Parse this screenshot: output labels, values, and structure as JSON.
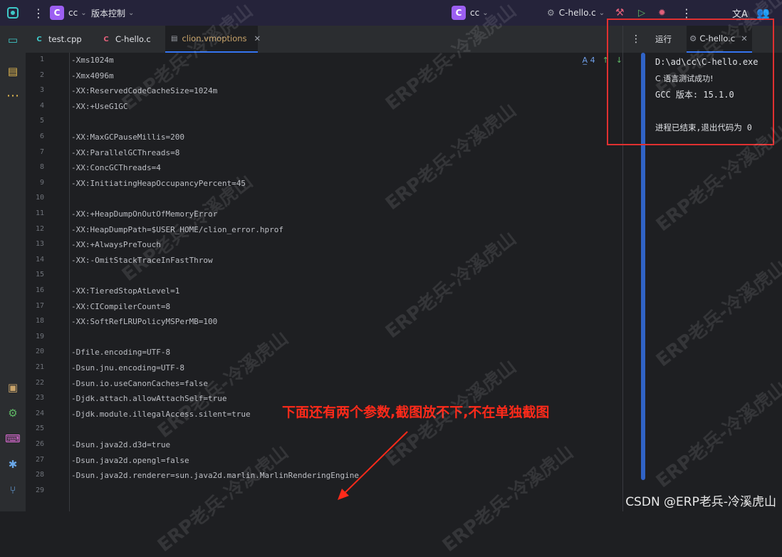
{
  "titlebar": {
    "project_badge": "C",
    "project_name": "cc",
    "vcs_label": "版本控制",
    "center_badge": "C",
    "center_name": "cc",
    "run_config": "C-hello.c"
  },
  "tabs": [
    {
      "label": "test.cpp",
      "icon": "C"
    },
    {
      "label": "C-hello.c",
      "icon": "C"
    },
    {
      "label": "clion.vmoptions",
      "icon": "file"
    }
  ],
  "editor": {
    "inspection_count": "4",
    "lines": [
      {
        "num": "1",
        "text": "-Xms1024m"
      },
      {
        "num": "2",
        "text": "-Xmx4096m"
      },
      {
        "num": "3",
        "text": "-XX:ReservedCodeCacheSize=1024m"
      },
      {
        "num": "4",
        "text": "-XX:+UseG1GC"
      },
      {
        "num": "5",
        "text": ""
      },
      {
        "num": "6",
        "text": "-XX:MaxGCPauseMillis=200"
      },
      {
        "num": "7",
        "text": "-XX:ParallelGCThreads=8"
      },
      {
        "num": "8",
        "text": "-XX:ConcGCThreads=4"
      },
      {
        "num": "9",
        "text": "-XX:InitiatingHeapOccupancyPercent=45"
      },
      {
        "num": "10",
        "text": ""
      },
      {
        "num": "11",
        "text": "-XX:+HeapDumpOnOutOfMemoryError"
      },
      {
        "num": "12",
        "text": "-XX:HeapDumpPath=$USER_HOME/clion_error.hprof"
      },
      {
        "num": "13",
        "text": "-XX:+AlwaysPreTouch"
      },
      {
        "num": "14",
        "text": "-XX:-OmitStackTraceInFastThrow"
      },
      {
        "num": "15",
        "text": ""
      },
      {
        "num": "16",
        "text": "-XX:TieredStopAtLevel=1"
      },
      {
        "num": "17",
        "text": "-XX:CICompilerCount=8"
      },
      {
        "num": "18",
        "text": "-XX:SoftRefLRUPolicyMSPerMB=100"
      },
      {
        "num": "19",
        "text": ""
      },
      {
        "num": "20",
        "text": "-Dfile.encoding=UTF-8"
      },
      {
        "num": "21",
        "text": "-Dsun.jnu.encoding=UTF-8"
      },
      {
        "num": "22",
        "text": "-Dsun.io.useCanonCaches=false"
      },
      {
        "num": "23",
        "text": "-Djdk.attach.allowAttachSelf=true"
      },
      {
        "num": "24",
        "text": "-Djdk.module.illegalAccess.silent=true"
      },
      {
        "num": "25",
        "text": ""
      },
      {
        "num": "26",
        "text": "-Dsun.java2d.d3d=true"
      },
      {
        "num": "27",
        "text": "-Dsun.java2d.opengl=false"
      },
      {
        "num": "28",
        "text": "-Dsun.java2d.renderer=sun.java2d.marlin.MarlinRenderingEngine"
      },
      {
        "num": "29",
        "text": ""
      }
    ]
  },
  "run_panel": {
    "tab_run": "运行",
    "tab_file": "C-hello.c",
    "output": [
      "D:\\ad\\cc\\C-hello.exe",
      "C 语言测试成功!",
      "GCC 版本: 15.1.0",
      "",
      "进程已结束,退出代码为 0"
    ]
  },
  "annotation": "下面还有两个参数,截图放不下,不在单独截图",
  "watermark": "ERP老兵-冷溪虎山",
  "footer_watermark": "CSDN @ERP老兵-冷溪虎山",
  "colors": {
    "accent": "#3574f0",
    "badge": "#9c5ff2",
    "annotation": "#ff2a1a",
    "highlight_box": "#e03030"
  }
}
